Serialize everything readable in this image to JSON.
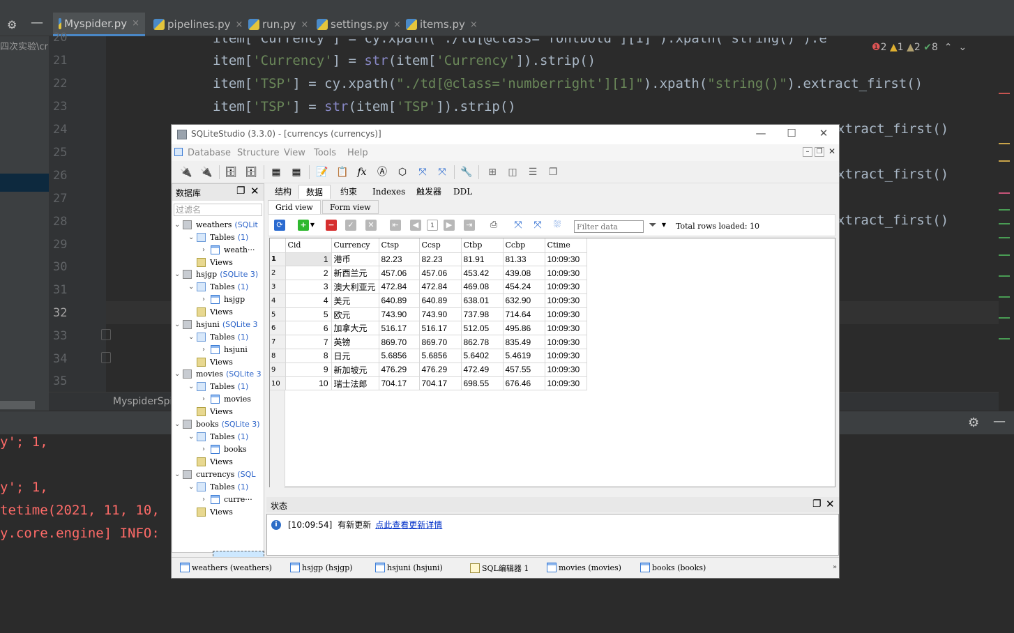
{
  "ide": {
    "project_path": "四次实验\\cr",
    "tabs": [
      "Myspider.py",
      "pipelines.py",
      "run.py",
      "settings.py",
      "items.py"
    ],
    "line_numbers": [
      "20",
      "21",
      "22",
      "23",
      "24",
      "25",
      "26",
      "27",
      "28",
      "29",
      "30",
      "31",
      "32",
      "33",
      "34",
      "35"
    ],
    "code": {
      "l20": "item['Currency'] = cy.xpath(\"./td[@class='fontbold'][1]\").xpath(\"string()\").extract_first()",
      "l21_a": "item[",
      "l21_s1": "'Currency'",
      "l21_b": "] = ",
      "l21_f": "str",
      "l21_c": "(item[",
      "l21_s2": "'Currency'",
      "l21_d": "]).strip()",
      "l22_a": "item[",
      "l22_s1": "'TSP'",
      "l22_b": "] = cy.xpath(",
      "l22_s2": "\"./td[@class='numberright'][1]\"",
      "l22_c": ").xpath(",
      "l22_s3": "\"string()\"",
      "l22_d": ").extract_first()",
      "l23_a": "item[",
      "l23_s1": "'TSP'",
      "l23_b": "] = ",
      "l23_f": "str",
      "l23_c": "(item[",
      "l23_s2": "'TSP'",
      "l23_d": "]).strip()",
      "frag24": "xtract_first()",
      "frag26": "xtract_first()",
      "frag28": "xtract_first()"
    },
    "inspections": {
      "errors": "2",
      "warnings": "1",
      "weak_warnings": "2",
      "ok": "8"
    },
    "breadcrumb": "MyspiderSpi",
    "console": [
      "y'; 1,",
      "y'; 1,",
      "tetime(2021, 11, 10,",
      "y.core.engine] INFO:"
    ],
    "colors": {
      "editor_bg": "#2b2b2b",
      "string": "#6a8759",
      "console_red": "#ff6b68"
    }
  },
  "sqlite": {
    "title": "SQLiteStudio (3.3.0) - [currencys (currencys)]",
    "menu": [
      "Database",
      "Structure",
      "View",
      "Tools",
      "Help"
    ],
    "db_panel_title": "数据库",
    "filter_placeholder": "过滤名",
    "tree": [
      {
        "db": "weathers",
        "tag": "(SQLit",
        "tables_label": "Tables",
        "count": "(1)",
        "table": "weath···",
        "views": "Views"
      },
      {
        "db": "hsjgp",
        "tag": "(SQLite 3)",
        "tables_label": "Tables",
        "count": "(1)",
        "table": "hsjgp",
        "views": "Views"
      },
      {
        "db": "hsjuni",
        "tag": "(SQLite 3",
        "tables_label": "Tables",
        "count": "(1)",
        "table": "hsjuni",
        "views": "Views"
      },
      {
        "db": "movies",
        "tag": "(SQLite 3",
        "tables_label": "Tables",
        "count": "(1)",
        "table": "movies",
        "views": "Views"
      },
      {
        "db": "books",
        "tag": "(SQLite 3)",
        "tables_label": "Tables",
        "count": "(1)",
        "table": "books",
        "views": "Views"
      },
      {
        "db": "currencys",
        "tag": "(SQL",
        "tables_label": "Tables",
        "count": "(1)",
        "table": "curre···",
        "views": "Views"
      }
    ],
    "top_tabs": [
      "结构",
      "数据",
      "约束",
      "Indexes",
      "触发器",
      "DDL"
    ],
    "view_tabs": [
      "Grid view",
      "Form view"
    ],
    "filter_data_placeholder": "Filter data",
    "page_number": "1",
    "rows_loaded": "Total rows loaded: 10",
    "columns": [
      "Cid",
      "Currency",
      "Ctsp",
      "Ccsp",
      "Ctbp",
      "Ccbp",
      "Ctime"
    ],
    "rows": [
      [
        "1",
        "1",
        "港币",
        "82.23",
        "82.23",
        "81.91",
        "81.33",
        "10:09:30"
      ],
      [
        "2",
        "2",
        "新西兰元",
        "457.06",
        "457.06",
        "453.42",
        "439.08",
        "10:09:30"
      ],
      [
        "3",
        "3",
        "澳大利亚元",
        "472.84",
        "472.84",
        "469.08",
        "454.24",
        "10:09:30"
      ],
      [
        "4",
        "4",
        "美元",
        "640.89",
        "640.89",
        "638.01",
        "632.90",
        "10:09:30"
      ],
      [
        "5",
        "5",
        "欧元",
        "743.90",
        "743.90",
        "737.98",
        "714.64",
        "10:09:30"
      ],
      [
        "6",
        "6",
        "加拿大元",
        "516.17",
        "516.17",
        "512.05",
        "495.86",
        "10:09:30"
      ],
      [
        "7",
        "7",
        "英镑",
        "869.70",
        "869.70",
        "862.78",
        "835.49",
        "10:09:30"
      ],
      [
        "8",
        "8",
        "日元",
        "5.6856",
        "5.6856",
        "5.6402",
        "5.4619",
        "10:09:30"
      ],
      [
        "9",
        "9",
        "新加坡元",
        "476.29",
        "476.29",
        "472.49",
        "457.55",
        "10:09:30"
      ],
      [
        "10",
        "10",
        "瑞士法郎",
        "704.17",
        "704.17",
        "698.55",
        "676.46",
        "10:09:30"
      ]
    ],
    "status_title": "状态",
    "status_time": "[10:09:54]",
    "status_msg": "有新更新",
    "status_link": "点此查看更新详情",
    "taskbar": [
      "weathers (weathers)",
      "hsjgp (hsjgp)",
      "hsjuni (hsjuni)",
      "SQL编辑器 1",
      "movies (movies)",
      "books (books)"
    ]
  }
}
